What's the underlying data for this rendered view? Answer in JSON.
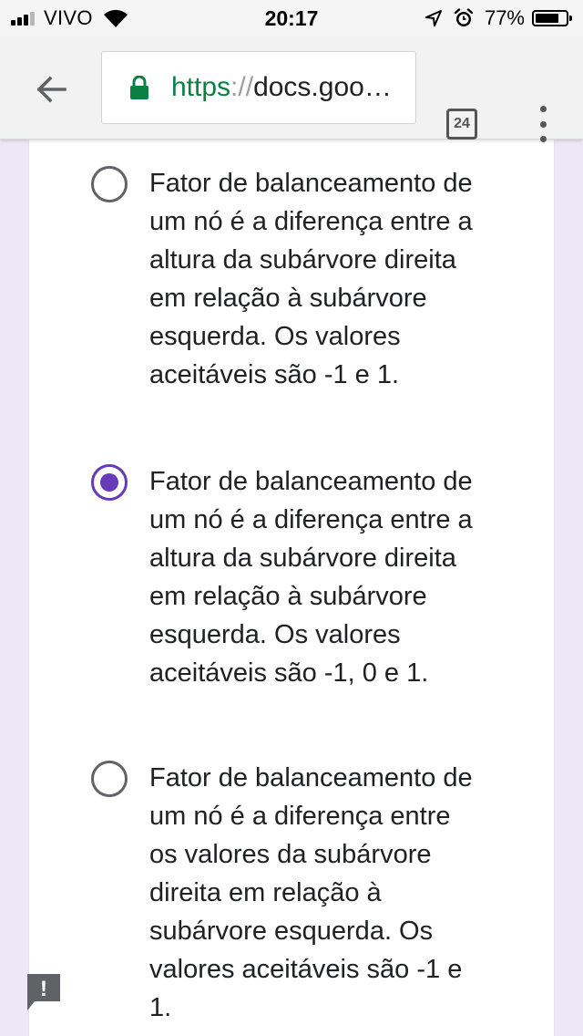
{
  "status_bar": {
    "carrier": "VIVO",
    "time": "20:17",
    "battery_percent": "77%",
    "battery_level": 0.77,
    "signal_bars_active": 3,
    "icons": [
      "signal-icon",
      "wifi-icon",
      "location-arrow-icon",
      "alarm-icon",
      "battery-icon"
    ]
  },
  "toolbar": {
    "url_scheme": "https",
    "url_separator": "://",
    "url_rest": "docs.goo…",
    "tab_count": "24",
    "icons": [
      "back-arrow-icon",
      "lock-icon",
      "menu-dots-icon"
    ]
  },
  "colors": {
    "accent": "#673ab7",
    "secure_green": "#0b8043",
    "page_background": "#ede7f6"
  },
  "options": [
    {
      "label": "Fator de balanceamento de um nó é a diferença entre a altura da subárvore direita em relação à subárvore esquerda. Os valores aceitáveis são -1 e 1.",
      "selected": false
    },
    {
      "label": "Fator de balanceamento de um nó é a diferença entre a altura da subárvore direita em relação à subárvore esquerda. Os valores aceitáveis são -1, 0 e 1.",
      "selected": true
    },
    {
      "label": "Fator de balanceamento de um nó é a diferença entre os valores da subárvore direita em relação à subárvore esquerda. Os valores aceitáveis são -1 e 1.",
      "selected": false
    }
  ],
  "report_button": {
    "glyph": "!"
  }
}
